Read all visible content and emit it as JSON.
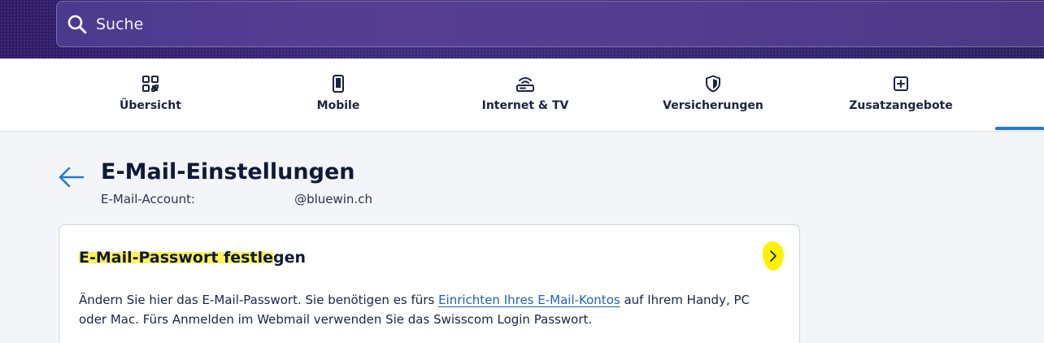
{
  "search": {
    "placeholder": "Suche"
  },
  "tabs": [
    {
      "label": "Übersicht",
      "icon": "grid-qr-icon"
    },
    {
      "label": "Mobile",
      "icon": "phone-icon"
    },
    {
      "label": "Internet & TV",
      "icon": "router-icon"
    },
    {
      "label": "Versicherungen",
      "icon": "shield-icon"
    },
    {
      "label": "Zusatzangebote",
      "icon": "plus-box-icon"
    }
  ],
  "header": {
    "title": "E-Mail-Einstellungen",
    "account_label": "E-Mail-Account:",
    "account_domain": "@bluewin.ch"
  },
  "card": {
    "title_highlighted": "E-Mail-Passwort festle",
    "title_rest": "gen",
    "text_before": "Ändern Sie hier das E-Mail-Passwort. Sie benötigen es fürs ",
    "link": "Einrichten Ihres E-Mail-Kontos",
    "text_after": " auf Ihrem Handy, PC oder Mac. Fürs Anmelden im Webmail verwenden Sie das Swisscom Login Passwort."
  },
  "colors": {
    "accent": "#1f7ad6",
    "highlight": "#fff25a",
    "header_bg": "#3c2a7e"
  }
}
